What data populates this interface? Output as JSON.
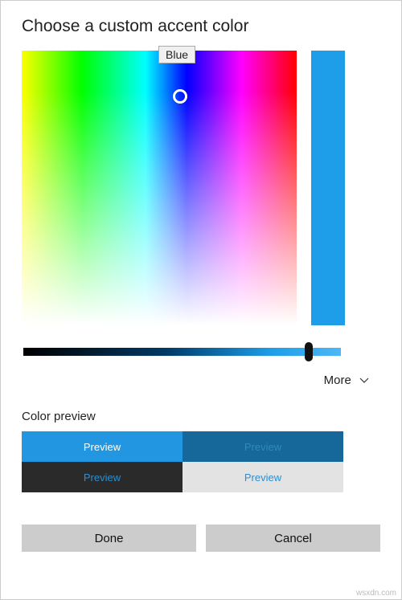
{
  "title": "Choose a custom accent color",
  "tooltip": "Blue",
  "accent_color": "#1e9de8",
  "more_label": "More",
  "section_label": "Color preview",
  "previews": [
    "Preview",
    "Preview",
    "Preview",
    "Preview"
  ],
  "buttons": {
    "done": "Done",
    "cancel": "Cancel"
  },
  "watermark": "wsxdn.com"
}
